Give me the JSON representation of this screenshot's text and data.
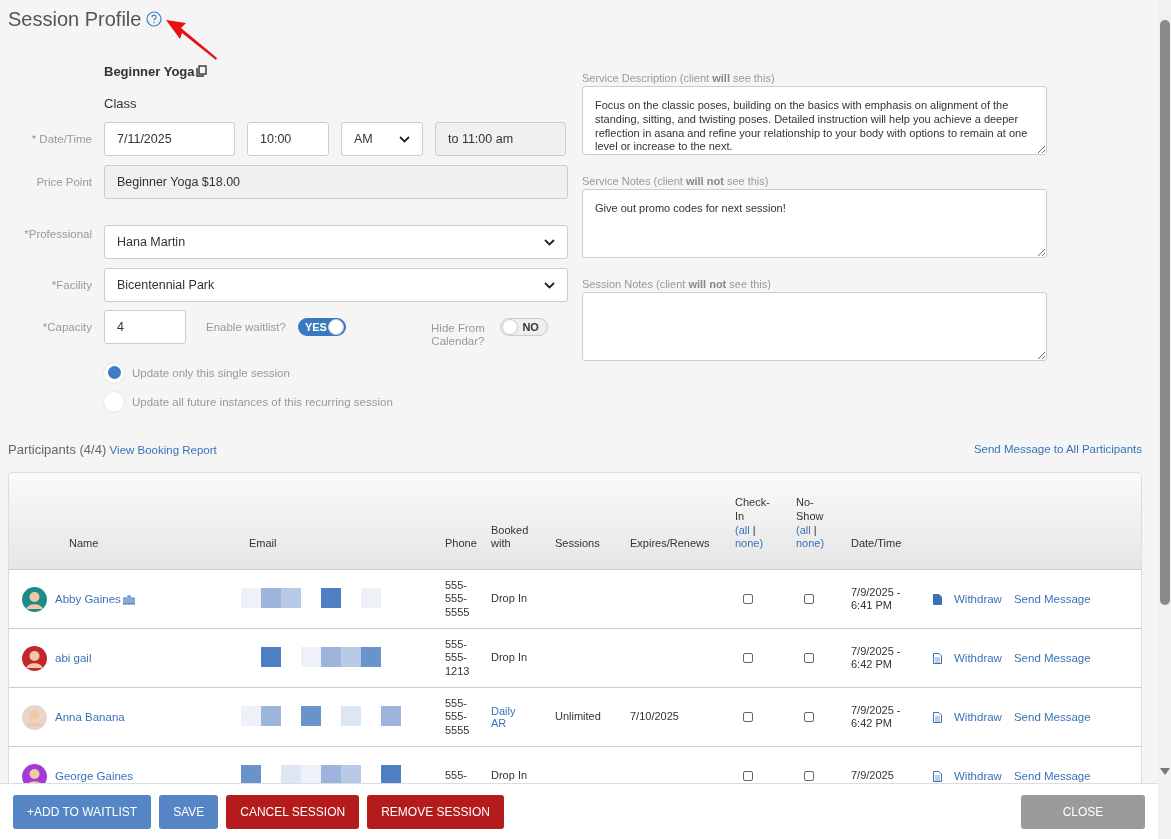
{
  "title": "Session Profile",
  "service": {
    "name": "Beginner Yoga",
    "type": "Class"
  },
  "form": {
    "date_label": "* Date/Time",
    "date": "7/11/2025",
    "time": "10:00",
    "ampm": "AM",
    "end_time": "to 11:00 am",
    "price_label": "Price Point",
    "price": "Beginner Yoga $18.00",
    "professional_label": "*Professional",
    "professional": "Hana Martin",
    "facility_label": "*Facility",
    "facility": "Bicentennial Park",
    "capacity_label": "*Capacity",
    "capacity": "4",
    "waitlist": {
      "label": "Enable waitlist?",
      "on": true,
      "text": "YES"
    },
    "hide": {
      "label": "Hide From Calendar?",
      "on": false,
      "text": "NO"
    },
    "radios": [
      {
        "label": "Update only this single session",
        "selected": true
      },
      {
        "label": "Update all future instances of this recurring session",
        "selected": false
      }
    ]
  },
  "notes": [
    {
      "label": "Service Description (client **will** see this)",
      "value": "Focus on the classic poses, building on the basics with emphasis on alignment of the standing, sitting, and twisting poses. Detailed instruction will help you achieve a deeper reflection in asana and refine your relationship to your body with options to remain at one level or increase to the next."
    },
    {
      "label": "Service Notes (client **will not** see this)",
      "value": "Give out promo codes for next session!"
    },
    {
      "label": "Session Notes (client **will not** see this)"
    }
  ],
  "participants": {
    "title": "Participants (4/4)",
    "report_link": "View Booking Report",
    "message_all": "Send Message to All Participants",
    "columns": {
      "name": "Name",
      "email": "Email",
      "phone": "Phone",
      "booked": "Booked with",
      "sessions": "Sessions",
      "expires": "Expires/Renews",
      "check_in": {
        "label": "Check-In",
        "all": "(all",
        "separator": "|",
        "none": "none)"
      },
      "no_show": {
        "label": "No-Show",
        "all": "(all",
        "separator": "|",
        "none": "none)"
      },
      "datetime": "Date/Time"
    },
    "rows": [
      {
        "name": "Abby Gaines",
        "color": "#1f8a8a",
        "group_icon": true,
        "phone": "555-555-5555",
        "booked": "Drop In",
        "booked_link": false,
        "sessions": "",
        "expires": "",
        "checked_in": false,
        "no_show": false,
        "datetime": "7/9/2025 - 6:41 PM",
        "note_filled": true,
        "withdraw": "Withdraw",
        "message": "Send Message"
      },
      {
        "name": "abi gail",
        "color": "#c0282d",
        "group_icon": false,
        "phone": "555-555-1213",
        "booked": "Drop In",
        "booked_link": false,
        "sessions": "",
        "expires": "",
        "checked_in": false,
        "no_show": false,
        "datetime": "7/9/2025 - 6:42 PM",
        "note_filled": false,
        "withdraw": "Withdraw",
        "message": "Send Message"
      },
      {
        "name": "Anna Banana",
        "color": "#e8d6cc",
        "group_icon": false,
        "phone": "555-555-5555",
        "booked": "Daily AR",
        "booked_link": true,
        "sessions": "Unlimited",
        "expires": "7/10/2025",
        "checked_in": false,
        "no_show": false,
        "datetime": "7/9/2025 - 6:42 PM",
        "note_filled": false,
        "withdraw": "Withdraw",
        "message": "Send Message"
      },
      {
        "name": "George Gaines",
        "color": "#a53ad6",
        "group_icon": false,
        "phone": "555-",
        "booked": "Drop In",
        "booked_link": false,
        "sessions": "",
        "expires": "",
        "checked_in": false,
        "no_show": false,
        "datetime": "7/9/2025",
        "note_filled": false,
        "withdraw": "Withdraw",
        "message": "Send Message"
      }
    ]
  },
  "buttons": [
    {
      "label": "+ADD TO WAITLIST",
      "kind": "primary"
    },
    {
      "label": "SAVE",
      "kind": "primary"
    },
    {
      "label": "CANCEL SESSION",
      "kind": "danger"
    },
    {
      "label": "REMOVE SESSION",
      "kind": "danger"
    },
    {
      "label": "CLOSE",
      "kind": "muted"
    }
  ]
}
